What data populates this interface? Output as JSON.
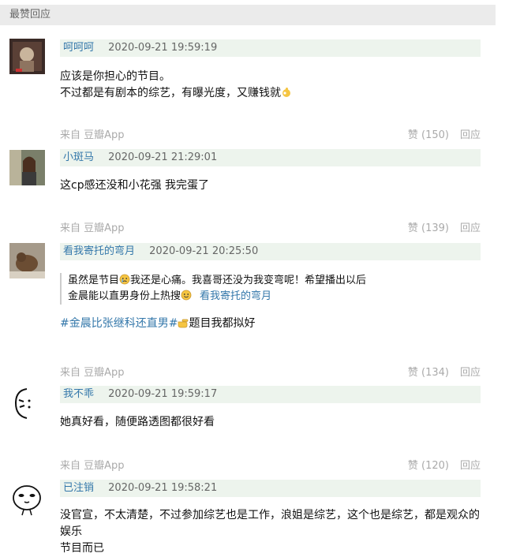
{
  "section_title": "最赞回应",
  "comments": [
    {
      "user": "呵呵呵",
      "time": "2020-09-21 19:59:19",
      "lines": [
        "应该是你担心的节目。",
        "不过都是有剧本的综艺，有曝光度，又赚钱就"
      ],
      "source": "来自 豆瓣App",
      "votes": "赞 (150)",
      "reply": "回应"
    },
    {
      "user": "小斑马",
      "time": "2020-09-21 21:29:01",
      "lines": [
        "这cp感还没和小花强 我完蛋了"
      ],
      "source": "来自 豆瓣App",
      "votes": "赞 (139)",
      "reply": "回应"
    },
    {
      "user": "看我寄托的弯月",
      "time": "2020-09-21 20:25:50",
      "quote_line1a": "虽然是节目",
      "quote_line1b": "我还是心痛。我喜哥还没为我变弯呢！希望播出以后",
      "quote_line2": "金晨能以直男身份上热搜",
      "quote_author": "看我寄托的弯月",
      "tag": "#金晨比张继科还直男#",
      "tag_suffix": "题目我都拟好",
      "source": "来自 豆瓣App",
      "votes": "赞 (134)",
      "reply": "回应"
    },
    {
      "user": "我不乖",
      "time": "2020-09-21 19:59:17",
      "lines": [
        "她真好看，随便路透图都很好看"
      ],
      "source": "来自 豆瓣App",
      "votes": "赞 (120)",
      "reply": "回应"
    },
    {
      "user": "已注销",
      "time": "2020-09-21 19:58:21",
      "lines": [
        "没官宣，不太清楚，不过参加综艺也是工作，浪姐是综艺，这个也是综艺，都是观众的娱乐",
        "节目而已"
      ]
    }
  ]
}
